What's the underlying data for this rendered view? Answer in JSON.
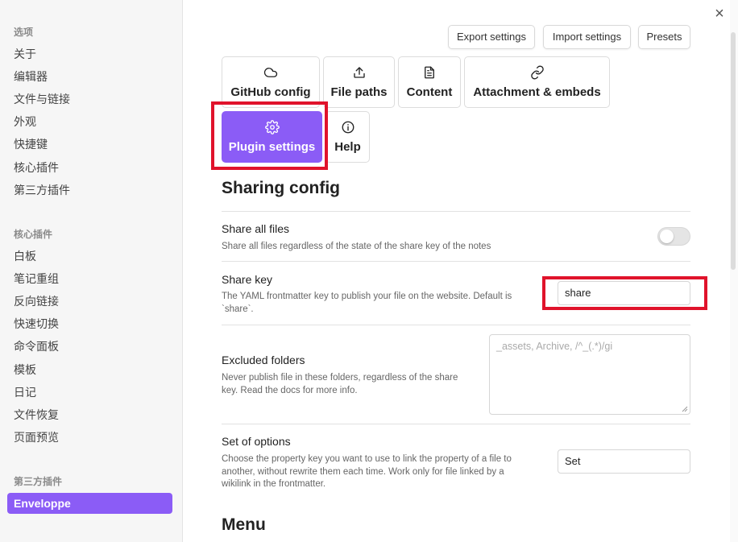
{
  "sidebar": {
    "group_options": "选项",
    "options": [
      "关于",
      "编辑器",
      "文件与链接",
      "外观",
      "快捷键",
      "核心插件",
      "第三方插件"
    ],
    "group_core": "核心插件",
    "core": [
      "白板",
      "笔记重组",
      "反向链接",
      "快速切换",
      "命令面板",
      "模板",
      "日记",
      "文件恢复",
      "页面预览"
    ],
    "group_third": "第三方插件",
    "active_plugin": "Enveloppe"
  },
  "top_buttons": {
    "export": "Export settings",
    "import": "Import settings",
    "presets": "Presets"
  },
  "tabs": {
    "github": "GitHub config",
    "paths": "File paths",
    "content": "Content",
    "attachment": "Attachment & embeds",
    "plugin": "Plugin settings",
    "help": "Help"
  },
  "section_title": "Sharing config",
  "settings": {
    "share_all": {
      "name": "Share all files",
      "desc": "Share all files regardless of the state of the share key of the notes",
      "enabled": false
    },
    "share_key": {
      "name": "Share key",
      "desc_line1": "The YAML frontmatter key to publish your file on the website. Default is",
      "desc_line2": "`share`.",
      "value": "share"
    },
    "excluded": {
      "name": "Excluded folders",
      "desc_line1": "Never publish file in these folders, regardless of the share",
      "desc_line2": "key. Read the docs for more info.",
      "placeholder": "_assets, Archive, /^_(.*)/gi"
    },
    "set_options": {
      "name": "Set of options",
      "desc_line1": "Choose the property key you want to use to link the property of a file to",
      "desc_line2": "another, without rewrite them each time. Work only for file linked by a",
      "desc_line3": "wikilink in the frontmatter.",
      "value": "Set"
    }
  },
  "menu_title": "Menu",
  "colors": {
    "accent": "#8b5cf6",
    "highlight": "#e0132b"
  },
  "icons": {
    "close": "×"
  }
}
